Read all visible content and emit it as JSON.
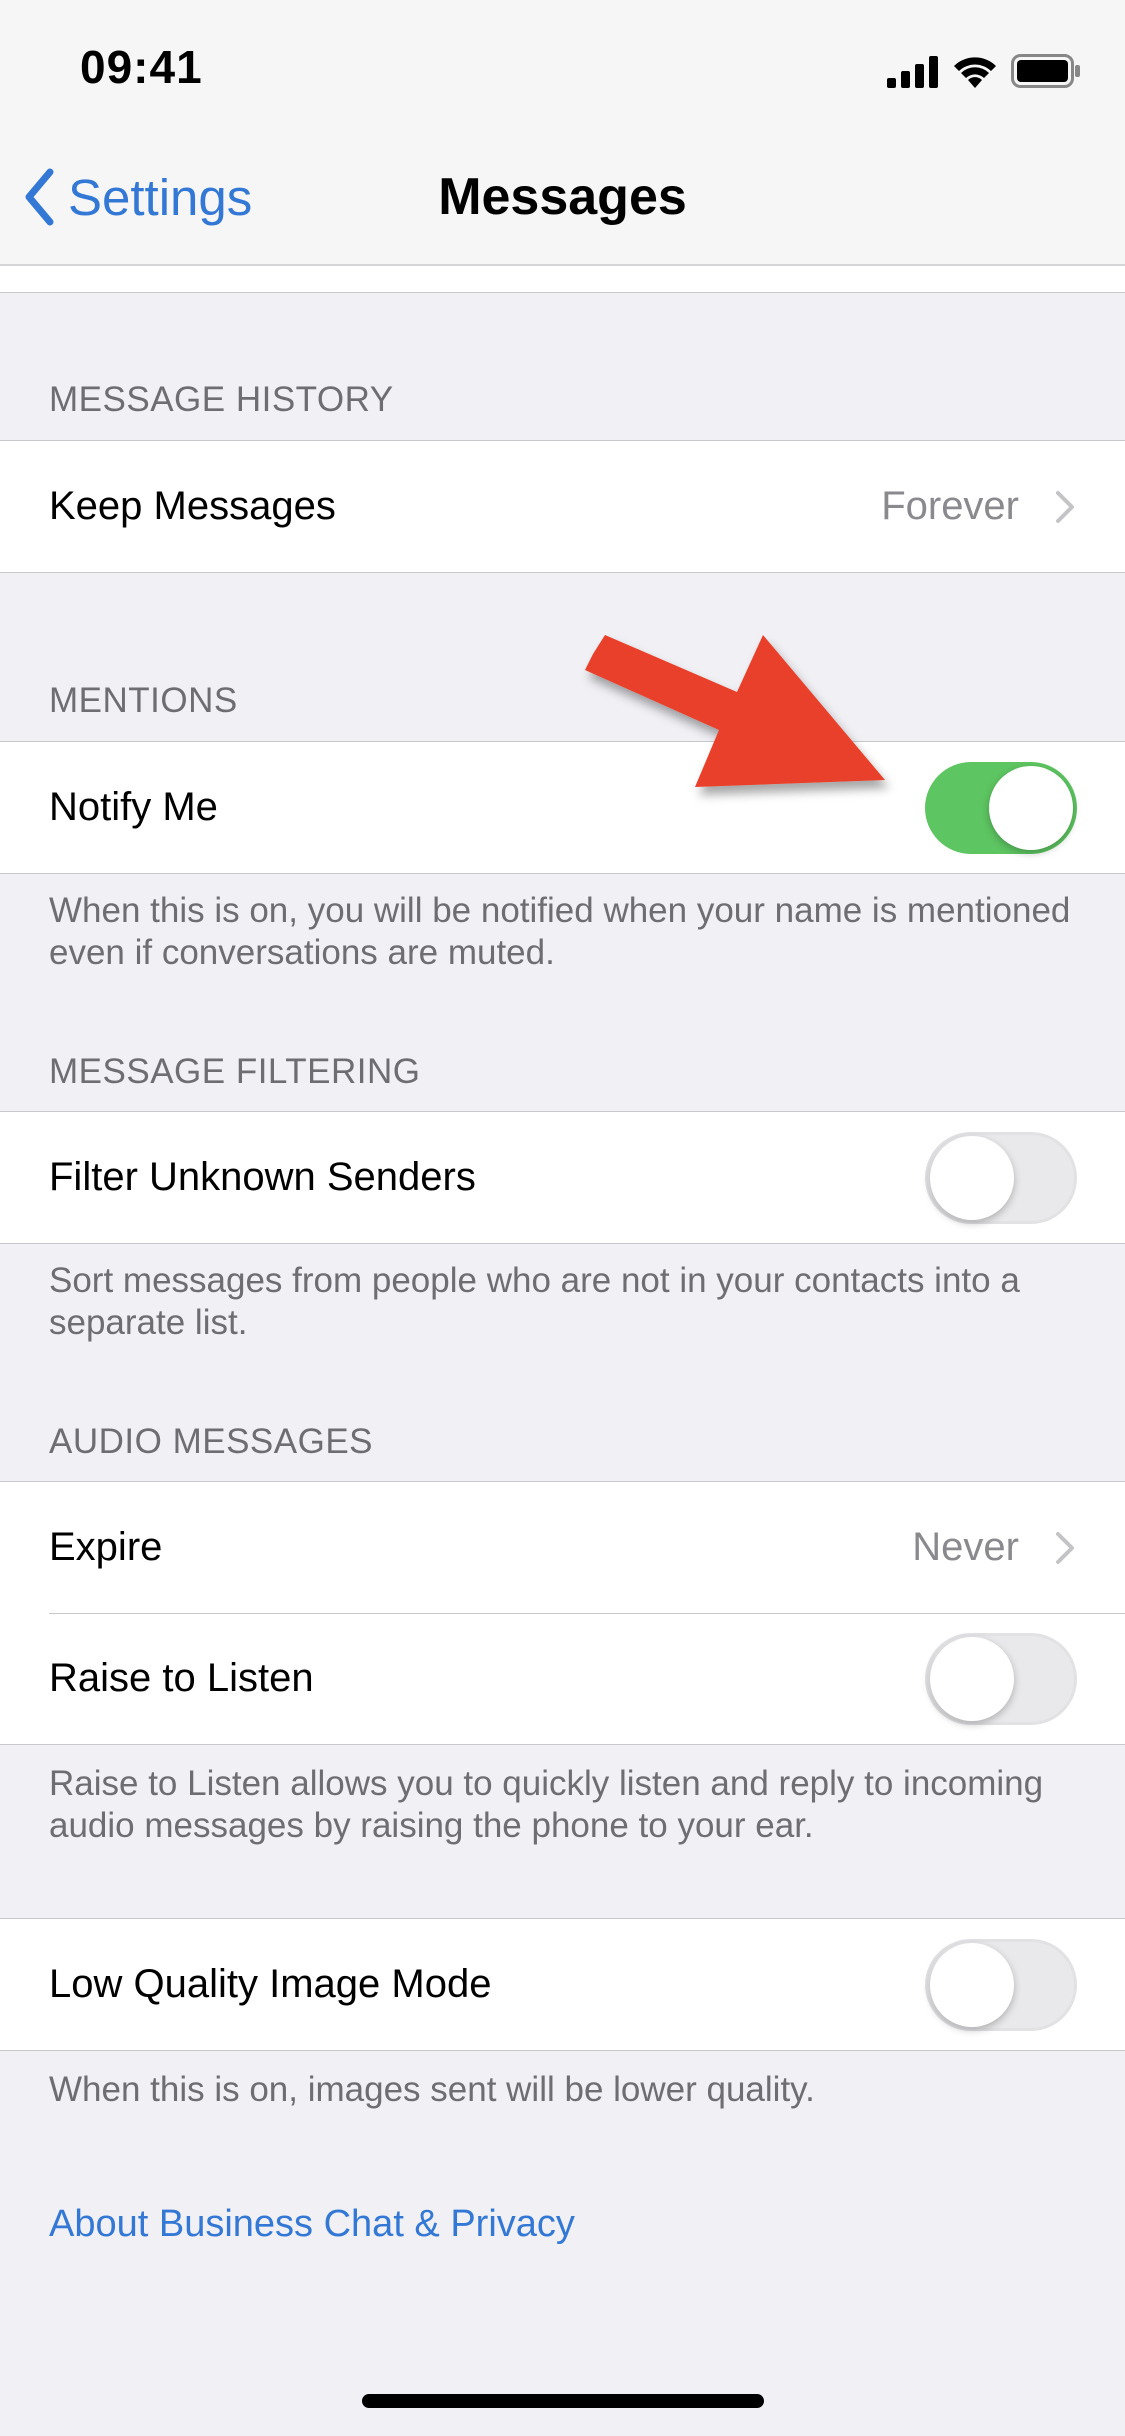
{
  "status_bar": {
    "time": "09:41",
    "icons": [
      "cellular-signal-icon",
      "wifi-icon",
      "battery-icon"
    ]
  },
  "nav": {
    "back_label": "Settings",
    "title": "Messages",
    "accent_color": "#3478D6"
  },
  "sections": {
    "message_history": {
      "header": "MESSAGE HISTORY",
      "keep_messages": {
        "label": "Keep Messages",
        "value": "Forever"
      }
    },
    "mentions": {
      "header": "MENTIONS",
      "notify_me": {
        "label": "Notify Me",
        "enabled": true
      },
      "footer": "When this is on, you will be notified when your name is mentioned even if conversations are muted."
    },
    "message_filtering": {
      "header": "MESSAGE FILTERING",
      "filter_unknown": {
        "label": "Filter Unknown Senders",
        "enabled": false
      },
      "footer": "Sort messages from people who are not in your contacts into a separate list."
    },
    "audio_messages": {
      "header": "AUDIO MESSAGES",
      "expire": {
        "label": "Expire",
        "value": "Never"
      },
      "raise_to_listen": {
        "label": "Raise to Listen",
        "enabled": false
      },
      "footer": "Raise to Listen allows you to quickly listen and reply to incoming audio messages by raising the phone to your ear."
    },
    "low_quality": {
      "low_quality_mode": {
        "label": "Low Quality Image Mode",
        "enabled": false
      },
      "footer": "When this is on, images sent will be lower quality."
    }
  },
  "about_link": "About Business Chat & Privacy",
  "colors": {
    "toggle_on": "#5DC561",
    "toggle_off": "#E9E9EB",
    "annotation_arrow": "#E8412A"
  }
}
